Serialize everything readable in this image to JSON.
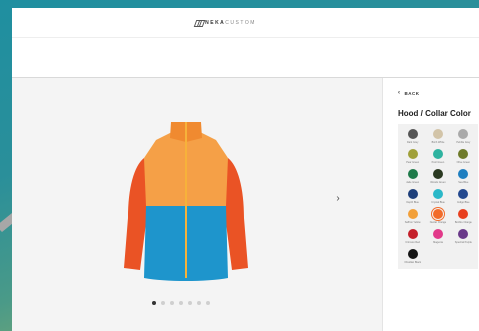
{
  "brand": {
    "name_bold": "NEKA",
    "name_thin": "CUSTOM"
  },
  "panel": {
    "back_label": "BACK",
    "title": "Hood / Collar Color",
    "swatches": [
      {
        "name": "Dark Grey",
        "color": "#555555"
      },
      {
        "name": "Birch White",
        "color": "#d2c4a8"
      },
      {
        "name": "Pebble Grey",
        "color": "#a9a9a9"
      },
      {
        "name": "Pear Green",
        "color": "#a0a03a"
      },
      {
        "name": "Pool Green",
        "color": "#2fb3a0"
      },
      {
        "name": "Olive Green",
        "color": "#6e7a2a"
      },
      {
        "name": "Jade Green",
        "color": "#1f7a4a"
      },
      {
        "name": "Woods Green",
        "color": "#2b3a22"
      },
      {
        "name": "Sea Blue",
        "color": "#1f7fc0"
      },
      {
        "name": "Depth Blue",
        "color": "#1e3f7a"
      },
      {
        "name": "Crystal Blue",
        "color": "#2bb8c8"
      },
      {
        "name": "Indigo Blue",
        "color": "#23498f"
      },
      {
        "name": "Saffron Yellow",
        "color": "#f2a03a"
      },
      {
        "name": "Nectar Orange",
        "color": "#f26b2a",
        "selected": true
      },
      {
        "name": "Bonfire Orange",
        "color": "#e8401f"
      },
      {
        "name": "Crimson Red",
        "color": "#c4202a"
      },
      {
        "name": "Magenta",
        "color": "#e23a8a"
      },
      {
        "name": "Spectral Purple",
        "color": "#6a3a8a"
      },
      {
        "name": "Obsidian Black",
        "color": "#151515"
      }
    ]
  },
  "carousel": {
    "slides": 7,
    "active_index": 0
  },
  "colors": {
    "jacket_top": "#f5a047",
    "jacket_bottom": "#1e95cc",
    "jacket_sleeves": "#ea5325",
    "jacket_collar": "#f08a30",
    "zipper": "#f7b23a"
  },
  "icons": {
    "back": "chevron-left-icon",
    "next": "chevron-right-icon"
  }
}
